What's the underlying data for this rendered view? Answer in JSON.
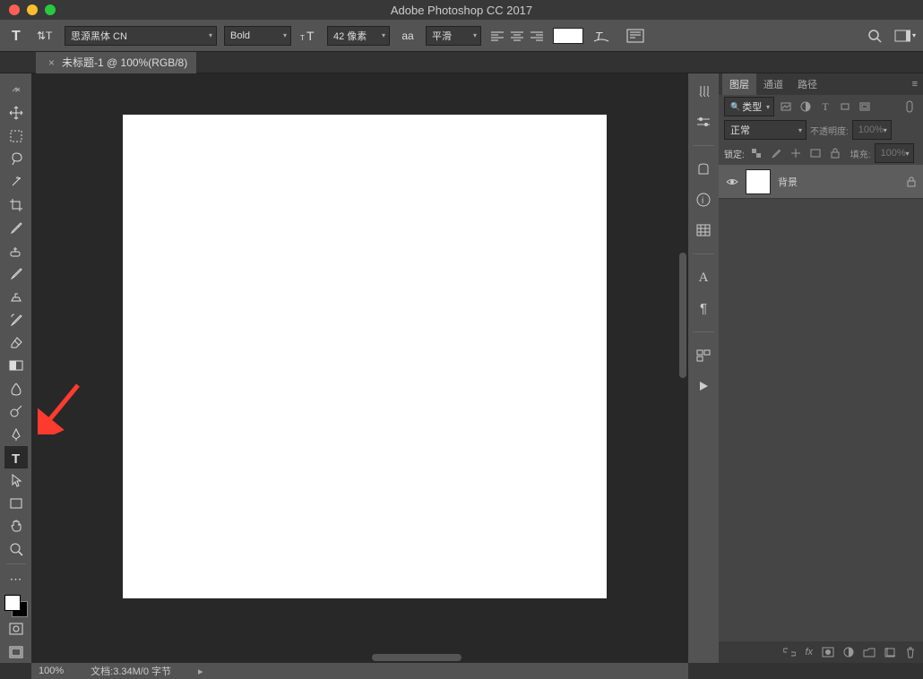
{
  "app": {
    "title": "Adobe Photoshop CC 2017"
  },
  "options": {
    "font": "思源黑体 CN",
    "weight": "Bold",
    "size": "42 像素",
    "aa_label": "平滑",
    "aa_prefix": "aa"
  },
  "document": {
    "tab_title": "未标题-1 @ 100%(RGB/8)"
  },
  "panels": {
    "layers_tab": "图层",
    "channels_tab": "通道",
    "paths_tab": "路径",
    "filter_type": "类型",
    "blend_mode": "正常",
    "opacity_label": "不透明度:",
    "opacity_value": "100%",
    "lock_label": "锁定:",
    "fill_label": "填充:",
    "fill_value": "100%",
    "layer_name": "背景"
  },
  "status": {
    "zoom": "100%",
    "doc_info": "文档:3.34M/0 字节"
  }
}
